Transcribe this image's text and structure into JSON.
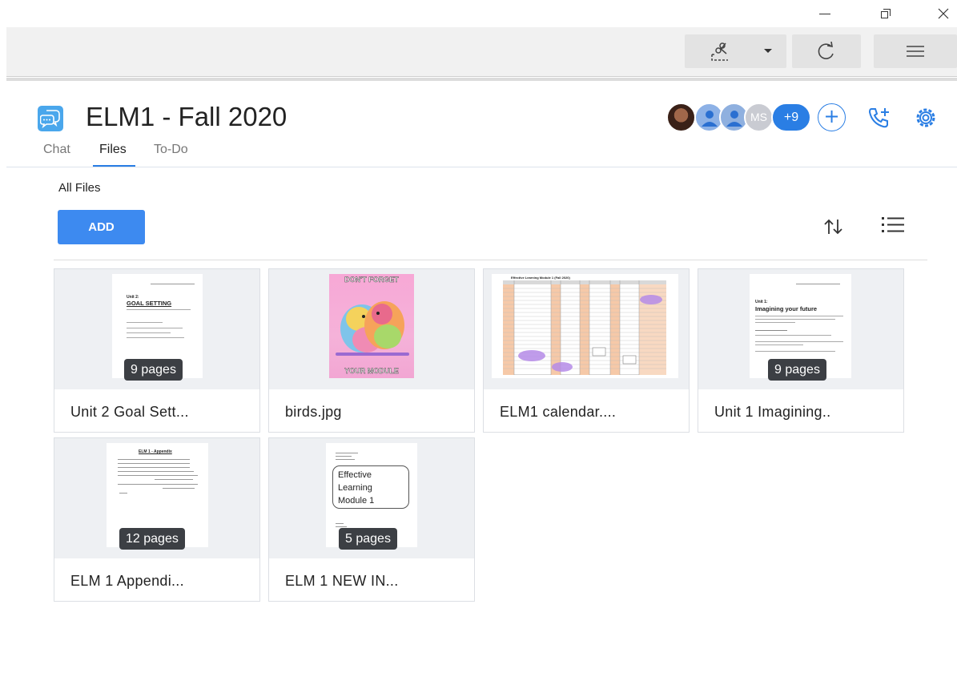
{
  "window": {
    "minimize_icon": "minimize-icon",
    "restore_icon": "restore-icon",
    "close_icon": "close-icon"
  },
  "toolbar": {
    "snip_icon": "snip-tool-icon",
    "refresh_icon": "refresh-icon",
    "menu_icon": "hamburger-menu-icon"
  },
  "channel": {
    "title": "ELM1 - Fall 2020",
    "icon": "chat-bubbles-icon",
    "member_initials": "MS",
    "more_members": "+9",
    "add_member": "+",
    "accent_color": "#2a7ee4"
  },
  "tabs": [
    {
      "label": "Chat",
      "active": false
    },
    {
      "label": "Files",
      "active": true
    },
    {
      "label": "To-Do",
      "active": false
    }
  ],
  "files_view": {
    "breadcrumb": "All Files",
    "add_label": "ADD",
    "sort_icon": "sort-icon",
    "view_icon": "list-view-icon"
  },
  "files": [
    {
      "name": "Unit 2 Goal Sett...",
      "pages": "9 pages",
      "thumb": {
        "heading_1": "Unit 2:",
        "heading_2": "GOAL SETTING"
      }
    },
    {
      "name": "birds.jpg",
      "pages": "",
      "thumb": {
        "top_text": "DON'T FORGET",
        "bottom_text": "YOUR MODULE"
      }
    },
    {
      "name": "ELM1 calendar....",
      "pages": "",
      "thumb": {
        "heading": "Effective Learning Module 1 (Fall 2020)"
      }
    },
    {
      "name": "Unit 1 Imagining..",
      "pages": "9 pages",
      "thumb": {
        "heading_1": "Unit 1:",
        "heading_2": "Imagining your future"
      }
    },
    {
      "name": "ELM 1 Appendi...",
      "pages": "12 pages",
      "thumb": {
        "heading": "ELM 1 - Appendix"
      }
    },
    {
      "name": "ELM 1 NEW IN...",
      "pages": "5 pages",
      "thumb": {
        "box_line_1": "Effective",
        "box_line_2": "Learning",
        "box_line_3": "Module 1"
      }
    }
  ]
}
